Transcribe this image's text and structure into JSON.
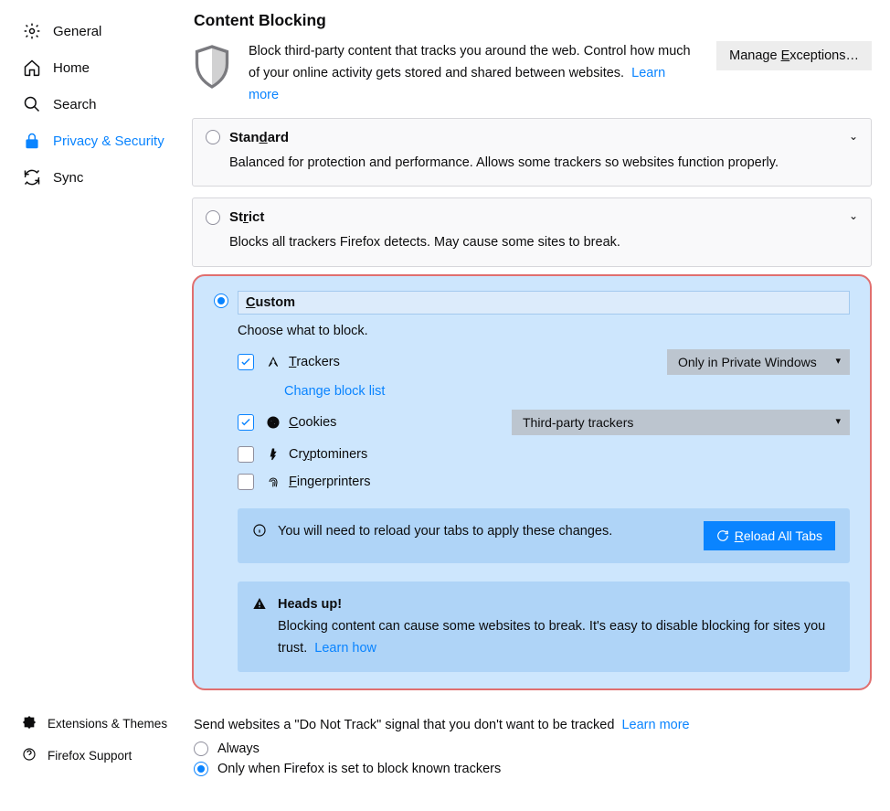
{
  "sidebar": {
    "items": [
      {
        "label": "General"
      },
      {
        "label": "Home"
      },
      {
        "label": "Search"
      },
      {
        "label": "Privacy & Security"
      },
      {
        "label": "Sync"
      }
    ],
    "lower": [
      {
        "label": "Extensions & Themes"
      },
      {
        "label": "Firefox Support"
      }
    ]
  },
  "title": "Content Blocking",
  "intro": "Block third-party content that tracks you around the web. Control how much of your online activity gets stored and shared between websites.",
  "learn_more": "Learn more",
  "manage_exceptions_pre": "Manage ",
  "manage_exceptions_key": "E",
  "manage_exceptions_post": "xceptions…",
  "standard": {
    "title_pre": "Stan",
    "title_key": "d",
    "title_post": "ard",
    "desc": "Balanced for protection and performance. Allows some trackers so websites function properly."
  },
  "strict": {
    "title_pre": "St",
    "title_key": "r",
    "title_post": "ict",
    "desc": "Blocks all trackers Firefox detects. May cause some sites to break."
  },
  "custom": {
    "title_key": "C",
    "title_post": "ustom",
    "desc": "Choose what to block.",
    "trackers_key": "T",
    "trackers_post": "rackers",
    "trackers_dropdown": "Only in Private Windows",
    "change_list": "Change block list",
    "cookies_key": "C",
    "cookies_post": "ookies",
    "cookies_dropdown": "Third-party trackers",
    "crypto_pre": "Cr",
    "crypto_key": "y",
    "crypto_post": "ptominers",
    "finger_key": "F",
    "finger_post": "ingerprinters",
    "reload_notice": "You will need to reload your tabs to apply these changes.",
    "reload_btn_key": "R",
    "reload_btn_post": "eload All Tabs",
    "heads_title": "Heads up!",
    "heads_body": "Blocking content can cause some websites to break. It's easy to disable blocking for sites you trust.",
    "learn_how": "Learn how"
  },
  "dnt": {
    "text": "Send websites a \"Do Not Track\" signal that you don't want to be tracked",
    "learn_more": "Learn more",
    "always": "Always",
    "only_when": "Only when Firefox is set to block known trackers"
  }
}
